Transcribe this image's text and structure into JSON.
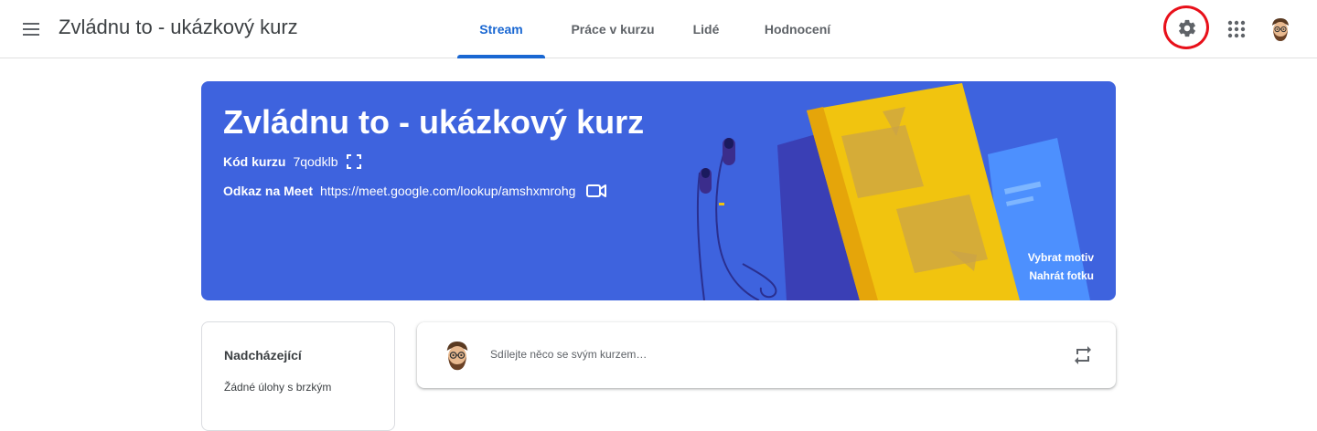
{
  "header": {
    "course_title": "Zvládnu to - ukázkový kurz",
    "tabs": [
      {
        "label": "Stream",
        "active": true
      },
      {
        "label": "Práce v kurzu",
        "active": false
      },
      {
        "label": "Lidé",
        "active": false
      },
      {
        "label": "Hodnocení",
        "active": false
      }
    ],
    "icons": [
      "menu-icon",
      "gear-icon",
      "apps-grid-icon",
      "user-avatar"
    ],
    "highlight_color": "#e8101a",
    "accent_color": "#1967d2"
  },
  "banner": {
    "title": "Zvládnu to - ukázkový kurz",
    "code_label": "Kód kurzu",
    "code_value": "7qodklb",
    "meet_label": "Odkaz na Meet",
    "meet_value": "https://meet.google.com/lookup/amshxmrohg",
    "select_theme": "Vybrat motiv",
    "upload_photo": "Nahrát fotku",
    "background_color": "#3e63de",
    "icons": [
      "expand-icon",
      "video-camera-icon"
    ]
  },
  "upcoming": {
    "title": "Nadcházející",
    "empty_text": "Žádné úlohy s brzkým"
  },
  "share": {
    "placeholder": "Sdílejte něco se svým kurzem…",
    "icons": [
      "user-avatar",
      "repost-icon"
    ]
  }
}
